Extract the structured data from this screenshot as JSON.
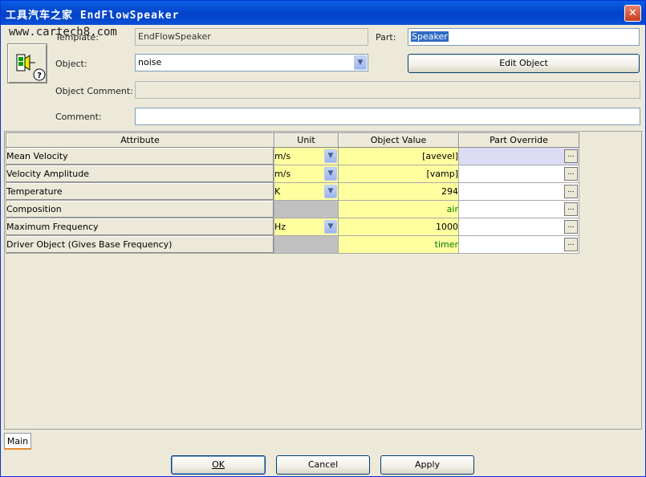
{
  "window": {
    "title": "工具汽车之家 EndFlowSpeaker",
    "close_glyph": "✕"
  },
  "watermark": "www.cartech8.com",
  "labels": {
    "template": "Template:",
    "part": "Part:",
    "object": "Object:",
    "object_comment": "Object Comment:",
    "comment": "Comment:"
  },
  "fields": {
    "template_value": "EndFlowSpeaker",
    "part_value": "Speaker",
    "object_value": "noise",
    "object_comment_value": "",
    "comment_value": ""
  },
  "buttons": {
    "edit_object": "Edit Object",
    "ok": "OK",
    "cancel": "Cancel",
    "apply": "Apply"
  },
  "table": {
    "headers": [
      "Attribute",
      "Unit",
      "Object Value",
      "Part Override"
    ],
    "rows": [
      {
        "attribute": "Mean Velocity",
        "unit": "m/s",
        "value": "[avevel]",
        "override": ""
      },
      {
        "attribute": "Velocity Amplitude",
        "unit": "m/s",
        "value": "[vamp]",
        "override": ""
      },
      {
        "attribute": "Temperature",
        "unit": "K",
        "value": "294",
        "override": ""
      },
      {
        "attribute": "Composition",
        "unit": "",
        "value": "air",
        "override": ""
      },
      {
        "attribute": "Maximum Frequency",
        "unit": "Hz",
        "value": "1000",
        "override": ""
      },
      {
        "attribute": "Driver Object (Gives Base Frequency)",
        "unit": "",
        "value": "timer",
        "override": ""
      }
    ]
  },
  "tabs": {
    "main": "Main"
  },
  "icons": {
    "part_icon": "speaker-part-icon",
    "help": "question-icon",
    "dropdown": "chevron-down-icon",
    "browse": "ellipsis-icon"
  },
  "colors": {
    "title_bar": "#0a4fd6",
    "value_cell": "#ffffa0",
    "selection": "#316ac5",
    "green_text": "#008000"
  }
}
